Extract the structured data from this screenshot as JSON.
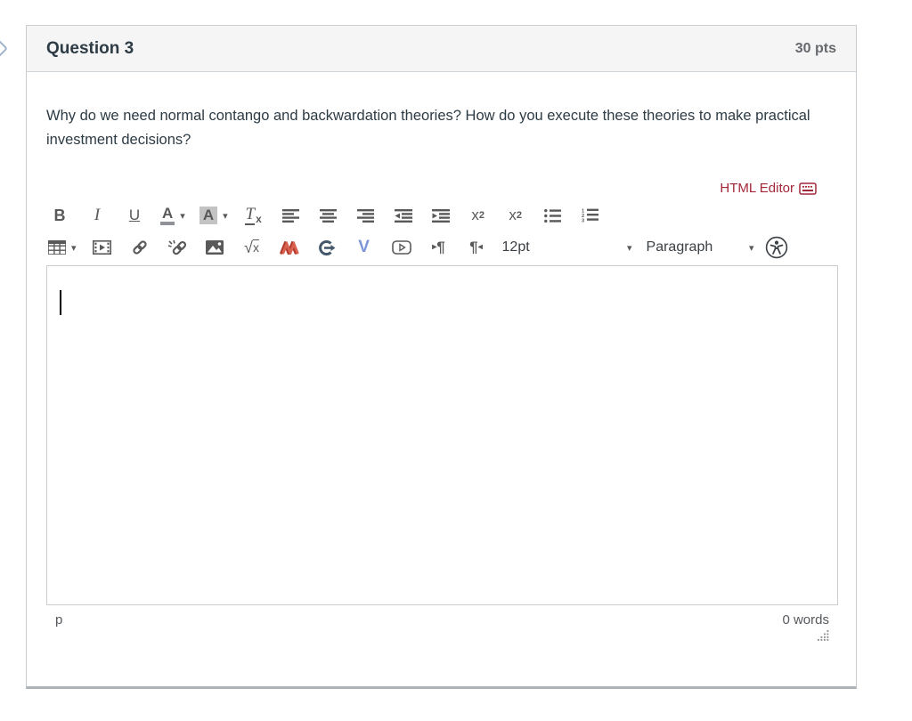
{
  "header": {
    "title": "Question 3",
    "points": "30 pts"
  },
  "question": {
    "text": "Why do we need normal contango and backwardation theories? How do you execute these theories to make practical investment decisions?"
  },
  "editor": {
    "html_editor_label": "HTML Editor",
    "toolbar": {
      "bold": "B",
      "italic": "I",
      "underline": "U",
      "forecolor": "A",
      "backcolor": "A",
      "clear_base": "T",
      "clear_mark": "x",
      "superscript_base": "x",
      "superscript_exp": "2",
      "subscript_base": "x",
      "subscript_sub": "2",
      "equation_radical": "√",
      "equation_var": "x",
      "font_size": "12pt",
      "paragraph_format": "Paragraph"
    },
    "status": {
      "path": "p",
      "words": "0 words"
    }
  },
  "icons": {
    "chevron_down": "▾",
    "pilcrow": "¶",
    "ltr_triangle": "▸",
    "rtl_triangle": "◂",
    "v_tool": "V"
  },
  "colors": {
    "accent_link": "#a32638",
    "icon_gray": "#595959",
    "red_tool": "#c64a3c",
    "slate_tool": "#45586b",
    "blue_tool": "#7d96d8",
    "header_bg": "#f5f5f5",
    "panel_border": "#c7cdd1",
    "text": "#2d3b45",
    "marker_border": "#9db3c8"
  }
}
